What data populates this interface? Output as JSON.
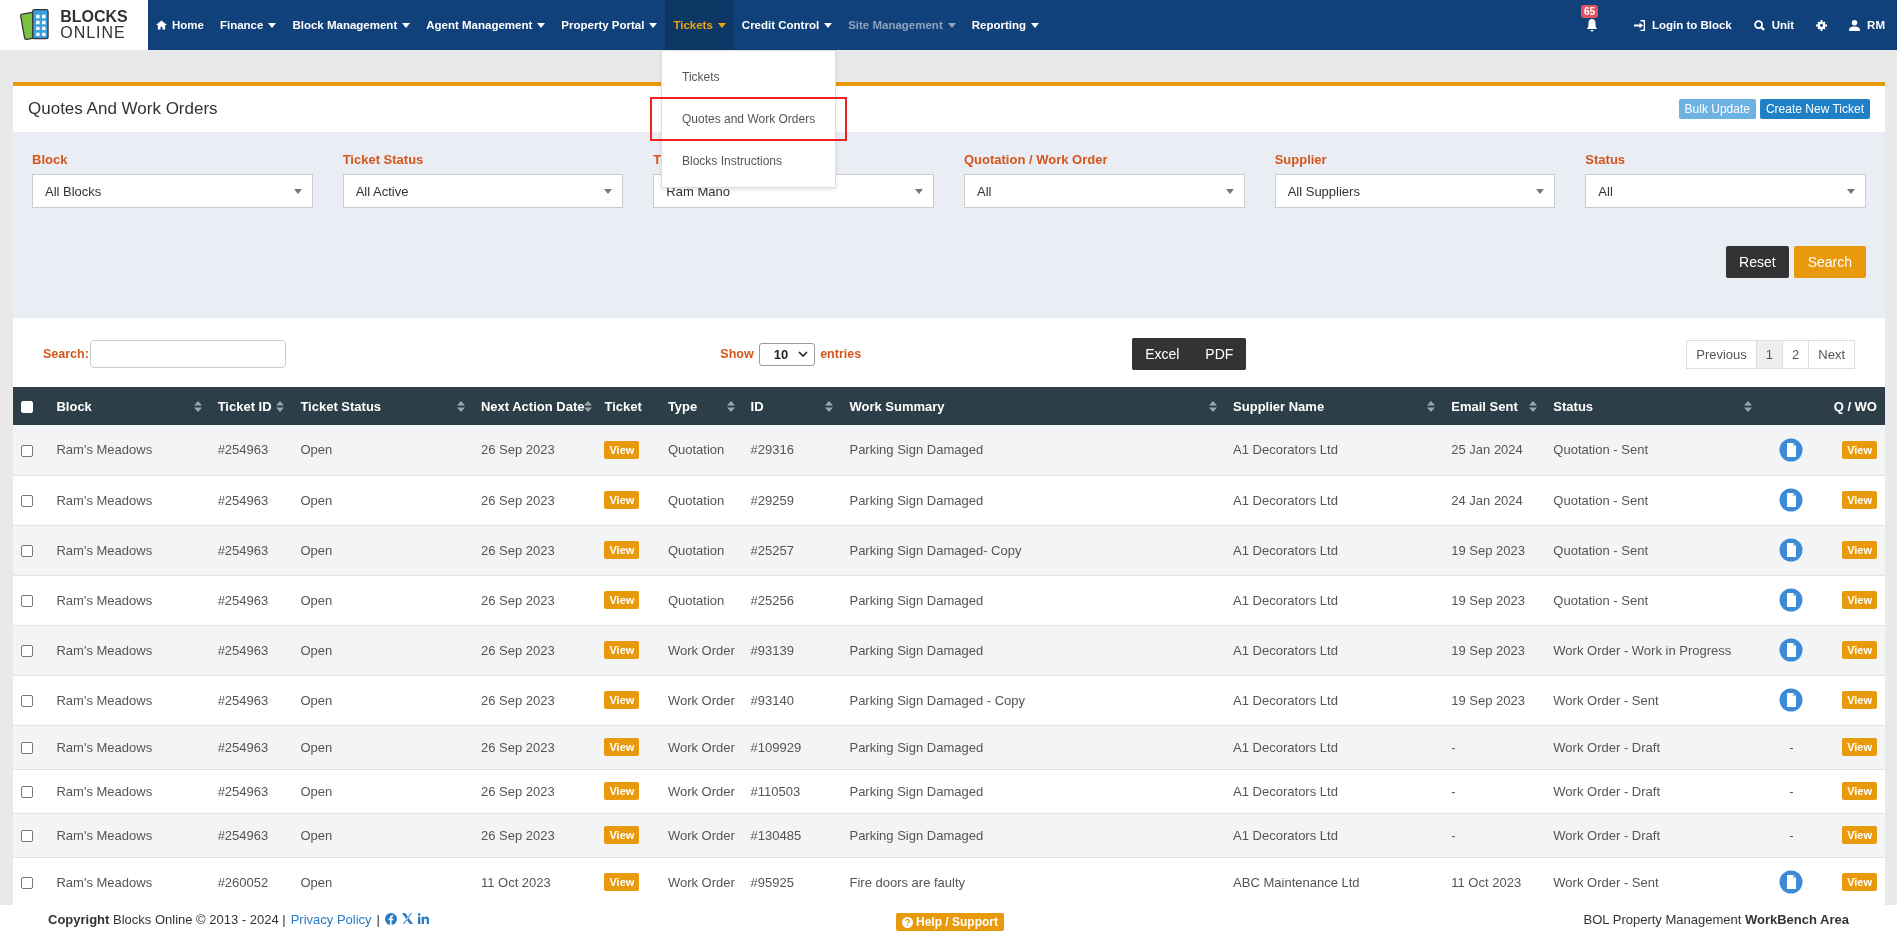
{
  "logo": {
    "line1": "BLOCKS",
    "line2": "ONLINE"
  },
  "nav": [
    {
      "label": "Home",
      "kind": "home",
      "selected": false,
      "disabled": false
    },
    {
      "label": "Finance",
      "kind": "menu",
      "selected": false,
      "disabled": false
    },
    {
      "label": "Block Management",
      "kind": "menu",
      "selected": false,
      "disabled": false
    },
    {
      "label": "Agent Management",
      "kind": "menu",
      "selected": false,
      "disabled": false
    },
    {
      "label": "Property Portal",
      "kind": "menu",
      "selected": false,
      "disabled": false
    },
    {
      "label": "Tickets",
      "kind": "menu",
      "selected": true,
      "disabled": false
    },
    {
      "label": "Credit Control",
      "kind": "menu",
      "selected": false,
      "disabled": false
    },
    {
      "label": "Site Management",
      "kind": "menu",
      "selected": false,
      "disabled": true
    },
    {
      "label": "Reporting",
      "kind": "menu",
      "selected": false,
      "disabled": false
    }
  ],
  "nav_right": {
    "notifications": "65",
    "items": [
      {
        "kind": "login",
        "label": "Login to Block"
      },
      {
        "kind": "search",
        "label": "Unit"
      },
      {
        "kind": "settings"
      },
      {
        "kind": "user",
        "label": "RM"
      }
    ]
  },
  "dropdown": [
    {
      "label": "Tickets",
      "highlighted": false
    },
    {
      "label": "Quotes and Work Orders",
      "highlighted": true
    },
    {
      "label": "Blocks Instructions",
      "highlighted": false
    }
  ],
  "page_title": "Quotes And Work Orders",
  "header_buttons": [
    {
      "label": "Bulk Update",
      "kind": "light"
    },
    {
      "label": "Create New Ticket",
      "kind": "primary"
    }
  ],
  "filters": [
    {
      "label": "Block",
      "value": "All Blocks"
    },
    {
      "label": "Ticket Status",
      "value": "All Active"
    },
    {
      "label": "T",
      "value": "Ram Mano"
    },
    {
      "label": "Quotation / Work Order",
      "value": "All"
    },
    {
      "label": "Supplier",
      "value": "All Suppliers"
    },
    {
      "label": "Status",
      "value": "All"
    }
  ],
  "filter_buttons": [
    {
      "label": "Reset",
      "kind": "dark"
    },
    {
      "label": "Search",
      "kind": "orange"
    }
  ],
  "search_label": "Search:",
  "length": {
    "before": "Show",
    "value": "10",
    "after": "entries"
  },
  "export_buttons": [
    "Excel",
    "PDF"
  ],
  "pagination": [
    {
      "label": "Previous",
      "selected": false
    },
    {
      "label": "1",
      "selected": true
    },
    {
      "label": "2",
      "selected": false
    },
    {
      "label": "Next",
      "selected": false
    }
  ],
  "table": {
    "select_all": {
      "checked": false
    },
    "columns": [
      {
        "label": "Block",
        "sort": true
      },
      {
        "label": "Ticket ID",
        "sort": true
      },
      {
        "label": "Ticket Status",
        "sort": true
      },
      {
        "label": "Next Action Date",
        "sort": true
      },
      {
        "label": "Ticket",
        "sort": false
      },
      {
        "label": "Type",
        "sort": true
      },
      {
        "label": "ID",
        "sort": true
      },
      {
        "label": "Work Summary",
        "sort": true
      },
      {
        "label": "Supplier Name",
        "sort": true
      },
      {
        "label": "Email Sent",
        "sort": true
      },
      {
        "label": "Status",
        "sort": true
      },
      {
        "sort": false
      },
      {
        "label": "Q / WO",
        "sort": false
      }
    ],
    "rows": [
      {
        "checked": false,
        "block": "Ram's Meadows",
        "ticket_id": "#254963",
        "ticket_status": "Open",
        "next_action": "26 Sep 2023",
        "ticket": "View",
        "type": "Quotation",
        "id": "#29316",
        "summary": "Parking Sign Damaged",
        "supplier": "A1 Decorators Ltd",
        "email_sent": "25 Jan 2024",
        "status": "Quotation - Sent",
        "document": true,
        "qwo": "View"
      },
      {
        "checked": false,
        "block": "Ram's Meadows",
        "ticket_id": "#254963",
        "ticket_status": "Open",
        "next_action": "26 Sep 2023",
        "ticket": "View",
        "type": "Quotation",
        "id": "#29259",
        "summary": "Parking Sign Damaged",
        "supplier": "A1 Decorators Ltd",
        "email_sent": "24 Jan 2024",
        "status": "Quotation - Sent",
        "document": true,
        "qwo": "View"
      },
      {
        "checked": false,
        "block": "Ram's Meadows",
        "ticket_id": "#254963",
        "ticket_status": "Open",
        "next_action": "26 Sep 2023",
        "ticket": "View",
        "type": "Quotation",
        "id": "#25257",
        "summary": "Parking Sign Damaged- Copy",
        "supplier": "A1 Decorators Ltd",
        "email_sent": "19 Sep 2023",
        "status": "Quotation - Sent",
        "document": true,
        "qwo": "View"
      },
      {
        "checked": false,
        "block": "Ram's Meadows",
        "ticket_id": "#254963",
        "ticket_status": "Open",
        "next_action": "26 Sep 2023",
        "ticket": "View",
        "type": "Quotation",
        "id": "#25256",
        "summary": "Parking Sign Damaged",
        "supplier": "A1 Decorators Ltd",
        "email_sent": "19 Sep 2023",
        "status": "Quotation - Sent",
        "document": true,
        "qwo": "View"
      },
      {
        "checked": false,
        "block": "Ram's Meadows",
        "ticket_id": "#254963",
        "ticket_status": "Open",
        "next_action": "26 Sep 2023",
        "ticket": "View",
        "type": "Work Order",
        "id": "#93139",
        "summary": "Parking Sign Damaged",
        "supplier": "A1 Decorators Ltd",
        "email_sent": "19 Sep 2023",
        "status": "Work Order - Work in Progress",
        "document": true,
        "qwo": "View"
      },
      {
        "checked": false,
        "block": "Ram's Meadows",
        "ticket_id": "#254963",
        "ticket_status": "Open",
        "next_action": "26 Sep 2023",
        "ticket": "View",
        "type": "Work Order",
        "id": "#93140",
        "summary": "Parking Sign Damaged - Copy",
        "supplier": "A1 Decorators Ltd",
        "email_sent": "19 Sep 2023",
        "status": "Work Order - Sent",
        "document": true,
        "qwo": "View"
      },
      {
        "checked": false,
        "block": "Ram's Meadows",
        "ticket_id": "#254963",
        "ticket_status": "Open",
        "next_action": "26 Sep 2023",
        "ticket": "View",
        "type": "Work Order",
        "id": "#109929",
        "summary": "Parking Sign Damaged",
        "supplier": "A1 Decorators Ltd",
        "email_sent": "-",
        "status": "Work Order - Draft",
        "document": false,
        "doc_text": "-",
        "qwo": "View"
      },
      {
        "checked": false,
        "block": "Ram's Meadows",
        "ticket_id": "#254963",
        "ticket_status": "Open",
        "next_action": "26 Sep 2023",
        "ticket": "View",
        "type": "Work Order",
        "id": "#110503",
        "summary": "Parking Sign Damaged",
        "supplier": "A1 Decorators Ltd",
        "email_sent": "-",
        "status": "Work Order - Draft",
        "document": false,
        "doc_text": "-",
        "qwo": "View"
      },
      {
        "checked": false,
        "block": "Ram's Meadows",
        "ticket_id": "#254963",
        "ticket_status": "Open",
        "next_action": "26 Sep 2023",
        "ticket": "View",
        "type": "Work Order",
        "id": "#130485",
        "summary": "Parking Sign Damaged",
        "supplier": "A1 Decorators Ltd",
        "email_sent": "-",
        "status": "Work Order - Draft",
        "document": false,
        "doc_text": "-",
        "qwo": "View"
      },
      {
        "checked": false,
        "block": "Ram's Meadows",
        "ticket_id": "#260052",
        "ticket_status": "Open",
        "next_action": "11 Oct 2023",
        "ticket": "View",
        "type": "Work Order",
        "id": "#95925",
        "summary": "Fire doors are faulty",
        "supplier": "ABC Maintenance Ltd",
        "email_sent": "11 Oct 2023",
        "status": "Work Order - Sent",
        "document": true,
        "qwo": "View"
      }
    ]
  },
  "footer": {
    "copyright": "**Copyright** Blocks Online © 2013 - 2024 |",
    "privacy": "Privacy Policy",
    "separator": "|",
    "help": "Help / Support",
    "right": "BOL Property Management **WorkBench Area**"
  }
}
